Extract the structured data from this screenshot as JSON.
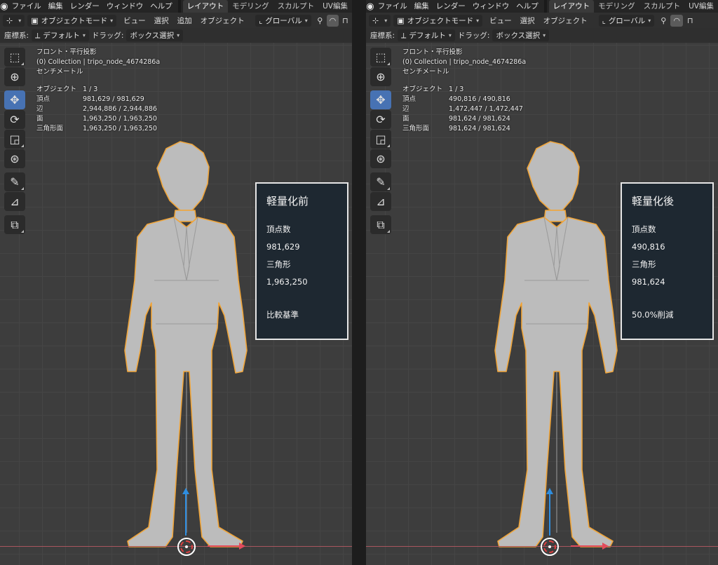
{
  "menubar": {
    "items": [
      "ファイル",
      "編集",
      "レンダー",
      "ウィンドウ",
      "ヘルプ"
    ],
    "workspaces_left": [
      "レイアウト",
      "モデリング",
      "スカルプト",
      "UV編集"
    ],
    "workspaces_right": [
      "レイアウト",
      "モデリング",
      "スカルプト",
      "UV編集"
    ]
  },
  "header": {
    "mode": "オブジェクトモード",
    "menus": [
      "ビュー",
      "選択",
      "追加",
      "オブジェクト"
    ],
    "menus_right": [
      "ビュー",
      "選択",
      "オブジェクト"
    ],
    "orientation": "グローバル"
  },
  "toolheader": {
    "coord_label": "座標系:",
    "coord_value": "デフォルト",
    "drag_label": "ドラッグ:",
    "drag_value": "ボックス選択"
  },
  "left": {
    "view_name": "フロント・平行投影",
    "collection": "(0) Collection | tripo_node_4674286a",
    "units": "センチメートル",
    "stats": {
      "objects_label": "オブジェクト",
      "objects": "1 / 3",
      "verts_label": "頂点",
      "verts": "981,629 / 981,629",
      "edges_label": "辺",
      "edges": "2,944,886 / 2,944,886",
      "faces_label": "面",
      "faces": "1,963,250 / 1,963,250",
      "tris_label": "三角形面",
      "tris": "1,963,250 / 1,963,250"
    },
    "info": {
      "title": "軽量化前",
      "verts_label": "頂点数",
      "verts": "981,629",
      "tris_label": "三角形",
      "tris": "1,963,250",
      "note": "比較基準"
    }
  },
  "right": {
    "view_name": "フロント・平行投影",
    "collection": "(0) Collection | tripo_node_4674286a",
    "units": "センチメートル",
    "stats": {
      "objects_label": "オブジェクト",
      "objects": "1 / 3",
      "verts_label": "頂点",
      "verts": "490,816 / 490,816",
      "edges_label": "辺",
      "edges": "1,472,447 / 1,472,447",
      "faces_label": "面",
      "faces": "981,624 / 981,624",
      "tris_label": "三角形面",
      "tris": "981,624 / 981,624"
    },
    "info": {
      "title": "軽量化後",
      "verts_label": "頂点数",
      "verts": "490,816",
      "tris_label": "三角形",
      "tris": "981,624",
      "note": "50.0%削減"
    }
  },
  "colors": {
    "viewport_bg": "#3d3d3d",
    "active_tool": "#4772b3",
    "selection_outline": "#f0a53a",
    "x_axis": "#e24b5c",
    "z_axis": "#2e8ee0",
    "info_bg": "#1e2831"
  }
}
